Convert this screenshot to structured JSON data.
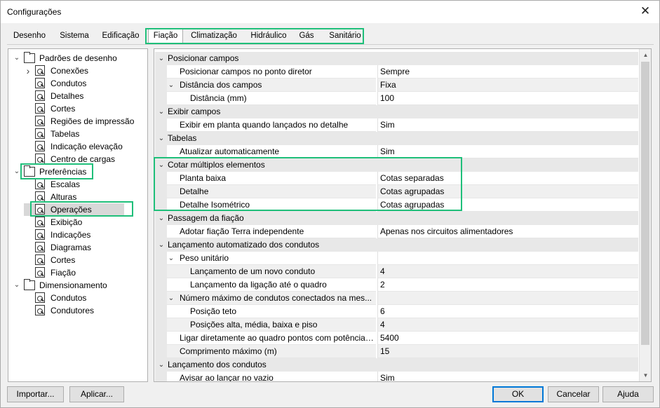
{
  "window": {
    "title": "Configurações",
    "close_glyph": "✕"
  },
  "tabs": [
    "Desenho",
    "Sistema",
    "Edificação",
    "Fiação",
    "Climatização",
    "Hidráulico",
    "Gás",
    "Sanitário"
  ],
  "active_tab": "Fiação",
  "tree": [
    {
      "label": "Padrões de desenho",
      "level": 0,
      "expander": "expanded",
      "icon": "folder-icon"
    },
    {
      "label": "Conexões",
      "level": 1,
      "expander": "collapsed",
      "icon": "settings-page-icon"
    },
    {
      "label": "Condutos",
      "level": 1,
      "expander": "none",
      "icon": "settings-page-icon"
    },
    {
      "label": "Detalhes",
      "level": 1,
      "expander": "none",
      "icon": "settings-page-icon"
    },
    {
      "label": "Cortes",
      "level": 1,
      "expander": "none",
      "icon": "settings-page-icon"
    },
    {
      "label": "Regiões de impressão",
      "level": 1,
      "expander": "none",
      "icon": "settings-page-icon"
    },
    {
      "label": "Tabelas",
      "level": 1,
      "expander": "none",
      "icon": "settings-page-icon"
    },
    {
      "label": "Indicação elevação",
      "level": 1,
      "expander": "none",
      "icon": "settings-page-icon"
    },
    {
      "label": "Centro de cargas",
      "level": 1,
      "expander": "none",
      "icon": "settings-page-icon"
    },
    {
      "label": "Preferências",
      "level": 0,
      "expander": "expanded",
      "icon": "folder-icon"
    },
    {
      "label": "Escalas",
      "level": 1,
      "expander": "none",
      "icon": "settings-page-icon"
    },
    {
      "label": "Alturas",
      "level": 1,
      "expander": "none",
      "icon": "settings-page-icon"
    },
    {
      "label": "Operações",
      "level": 1,
      "expander": "none",
      "icon": "settings-page-icon",
      "selected": true
    },
    {
      "label": "Exibição",
      "level": 1,
      "expander": "none",
      "icon": "settings-page-icon"
    },
    {
      "label": "Indicações",
      "level": 1,
      "expander": "none",
      "icon": "settings-page-icon"
    },
    {
      "label": "Diagramas",
      "level": 1,
      "expander": "none",
      "icon": "settings-page-icon"
    },
    {
      "label": "Cortes",
      "level": 1,
      "expander": "none",
      "icon": "settings-page-icon"
    },
    {
      "label": "Fiação",
      "level": 1,
      "expander": "none",
      "icon": "settings-page-icon"
    },
    {
      "label": "Dimensionamento",
      "level": 0,
      "expander": "expanded",
      "icon": "folder-icon"
    },
    {
      "label": "Condutos",
      "level": 1,
      "expander": "none",
      "icon": "settings-page-icon"
    },
    {
      "label": "Condutores",
      "level": 1,
      "expander": "none",
      "icon": "settings-page-icon"
    }
  ],
  "properties": [
    {
      "type": "category",
      "name": "Posicionar campos"
    },
    {
      "type": "prop",
      "level": 1,
      "name": "Posicionar campos no ponto diretor",
      "value": "Sempre"
    },
    {
      "type": "prop",
      "level": 1,
      "name": "Distância dos campos",
      "value": "Fixa",
      "expander": "expanded"
    },
    {
      "type": "prop",
      "level": 2,
      "name": "Distância (mm)",
      "value": "100"
    },
    {
      "type": "category",
      "name": "Exibir campos"
    },
    {
      "type": "prop",
      "level": 1,
      "name": "Exibir em planta quando lançados no detalhe",
      "value": "Sim"
    },
    {
      "type": "category",
      "name": "Tabelas"
    },
    {
      "type": "prop",
      "level": 1,
      "name": "Atualizar automaticamente",
      "value": "Sim"
    },
    {
      "type": "category",
      "name": "Cotar múltiplos elementos"
    },
    {
      "type": "prop",
      "level": 1,
      "name": "Planta baixa",
      "value": "Cotas separadas"
    },
    {
      "type": "prop",
      "level": 1,
      "name": "Detalhe",
      "value": "Cotas agrupadas"
    },
    {
      "type": "prop",
      "level": 1,
      "name": "Detalhe Isométrico",
      "value": "Cotas agrupadas"
    },
    {
      "type": "category",
      "name": "Passagem da fiação"
    },
    {
      "type": "prop",
      "level": 1,
      "name": "Adotar fiação Terra independente",
      "value": "Apenas nos circuitos alimentadores"
    },
    {
      "type": "category",
      "name": "Lançamento automatizado dos condutos"
    },
    {
      "type": "prop",
      "level": 1,
      "name": "Peso unitário",
      "value": "",
      "expander": "expanded"
    },
    {
      "type": "prop",
      "level": 2,
      "name": "Lançamento de um novo conduto",
      "value": "4"
    },
    {
      "type": "prop",
      "level": 2,
      "name": "Lançamento da ligação até o quadro",
      "value": "2"
    },
    {
      "type": "prop",
      "level": 1,
      "name": "Número máximo de condutos conectados na mes...",
      "value": "",
      "expander": "expanded"
    },
    {
      "type": "prop",
      "level": 2,
      "name": "Posição teto",
      "value": "6"
    },
    {
      "type": "prop",
      "level": 2,
      "name": "Posições alta, média, baixa e piso",
      "value": "4"
    },
    {
      "type": "prop",
      "level": 1,
      "name": "Ligar diretamente ao quadro pontos com potência ...",
      "value": "5400"
    },
    {
      "type": "prop",
      "level": 1,
      "name": "Comprimento máximo (m)",
      "value": "15"
    },
    {
      "type": "category",
      "name": "Lançamento dos condutos"
    },
    {
      "type": "prop",
      "level": 1,
      "name": "Avisar ao lançar no vazio",
      "value": "Sim"
    }
  ],
  "buttons": {
    "import": "Importar...",
    "apply": "Aplicar...",
    "ok": "OK",
    "cancel": "Cancelar",
    "help": "Ajuda"
  },
  "glyphs": {
    "expanded": "⌄",
    "collapsed": "›",
    "scroll_up": "▲",
    "scroll_down": "▼"
  },
  "colors": {
    "highlight": "#1fbf7a",
    "default_button_border": "#0078d7"
  }
}
